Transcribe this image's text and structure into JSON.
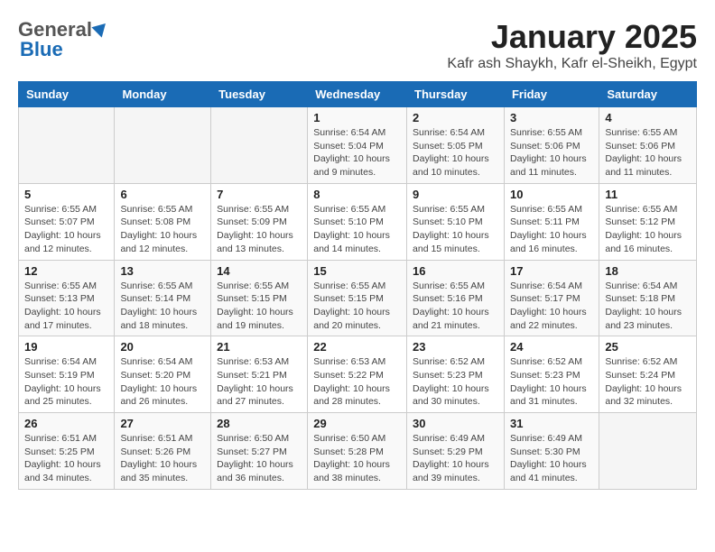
{
  "header": {
    "logo_general": "General",
    "logo_blue": "Blue",
    "month_title": "January 2025",
    "location": "Kafr ash Shaykh, Kafr el-Sheikh, Egypt"
  },
  "days_of_week": [
    "Sunday",
    "Monday",
    "Tuesday",
    "Wednesday",
    "Thursday",
    "Friday",
    "Saturday"
  ],
  "weeks": [
    {
      "days": [
        {
          "num": "",
          "info": ""
        },
        {
          "num": "",
          "info": ""
        },
        {
          "num": "",
          "info": ""
        },
        {
          "num": "1",
          "info": "Sunrise: 6:54 AM\nSunset: 5:04 PM\nDaylight: 10 hours\nand 9 minutes."
        },
        {
          "num": "2",
          "info": "Sunrise: 6:54 AM\nSunset: 5:05 PM\nDaylight: 10 hours\nand 10 minutes."
        },
        {
          "num": "3",
          "info": "Sunrise: 6:55 AM\nSunset: 5:06 PM\nDaylight: 10 hours\nand 11 minutes."
        },
        {
          "num": "4",
          "info": "Sunrise: 6:55 AM\nSunset: 5:06 PM\nDaylight: 10 hours\nand 11 minutes."
        }
      ]
    },
    {
      "days": [
        {
          "num": "5",
          "info": "Sunrise: 6:55 AM\nSunset: 5:07 PM\nDaylight: 10 hours\nand 12 minutes."
        },
        {
          "num": "6",
          "info": "Sunrise: 6:55 AM\nSunset: 5:08 PM\nDaylight: 10 hours\nand 12 minutes."
        },
        {
          "num": "7",
          "info": "Sunrise: 6:55 AM\nSunset: 5:09 PM\nDaylight: 10 hours\nand 13 minutes."
        },
        {
          "num": "8",
          "info": "Sunrise: 6:55 AM\nSunset: 5:10 PM\nDaylight: 10 hours\nand 14 minutes."
        },
        {
          "num": "9",
          "info": "Sunrise: 6:55 AM\nSunset: 5:10 PM\nDaylight: 10 hours\nand 15 minutes."
        },
        {
          "num": "10",
          "info": "Sunrise: 6:55 AM\nSunset: 5:11 PM\nDaylight: 10 hours\nand 16 minutes."
        },
        {
          "num": "11",
          "info": "Sunrise: 6:55 AM\nSunset: 5:12 PM\nDaylight: 10 hours\nand 16 minutes."
        }
      ]
    },
    {
      "days": [
        {
          "num": "12",
          "info": "Sunrise: 6:55 AM\nSunset: 5:13 PM\nDaylight: 10 hours\nand 17 minutes."
        },
        {
          "num": "13",
          "info": "Sunrise: 6:55 AM\nSunset: 5:14 PM\nDaylight: 10 hours\nand 18 minutes."
        },
        {
          "num": "14",
          "info": "Sunrise: 6:55 AM\nSunset: 5:15 PM\nDaylight: 10 hours\nand 19 minutes."
        },
        {
          "num": "15",
          "info": "Sunrise: 6:55 AM\nSunset: 5:15 PM\nDaylight: 10 hours\nand 20 minutes."
        },
        {
          "num": "16",
          "info": "Sunrise: 6:55 AM\nSunset: 5:16 PM\nDaylight: 10 hours\nand 21 minutes."
        },
        {
          "num": "17",
          "info": "Sunrise: 6:54 AM\nSunset: 5:17 PM\nDaylight: 10 hours\nand 22 minutes."
        },
        {
          "num": "18",
          "info": "Sunrise: 6:54 AM\nSunset: 5:18 PM\nDaylight: 10 hours\nand 23 minutes."
        }
      ]
    },
    {
      "days": [
        {
          "num": "19",
          "info": "Sunrise: 6:54 AM\nSunset: 5:19 PM\nDaylight: 10 hours\nand 25 minutes."
        },
        {
          "num": "20",
          "info": "Sunrise: 6:54 AM\nSunset: 5:20 PM\nDaylight: 10 hours\nand 26 minutes."
        },
        {
          "num": "21",
          "info": "Sunrise: 6:53 AM\nSunset: 5:21 PM\nDaylight: 10 hours\nand 27 minutes."
        },
        {
          "num": "22",
          "info": "Sunrise: 6:53 AM\nSunset: 5:22 PM\nDaylight: 10 hours\nand 28 minutes."
        },
        {
          "num": "23",
          "info": "Sunrise: 6:52 AM\nSunset: 5:23 PM\nDaylight: 10 hours\nand 30 minutes."
        },
        {
          "num": "24",
          "info": "Sunrise: 6:52 AM\nSunset: 5:23 PM\nDaylight: 10 hours\nand 31 minutes."
        },
        {
          "num": "25",
          "info": "Sunrise: 6:52 AM\nSunset: 5:24 PM\nDaylight: 10 hours\nand 32 minutes."
        }
      ]
    },
    {
      "days": [
        {
          "num": "26",
          "info": "Sunrise: 6:51 AM\nSunset: 5:25 PM\nDaylight: 10 hours\nand 34 minutes."
        },
        {
          "num": "27",
          "info": "Sunrise: 6:51 AM\nSunset: 5:26 PM\nDaylight: 10 hours\nand 35 minutes."
        },
        {
          "num": "28",
          "info": "Sunrise: 6:50 AM\nSunset: 5:27 PM\nDaylight: 10 hours\nand 36 minutes."
        },
        {
          "num": "29",
          "info": "Sunrise: 6:50 AM\nSunset: 5:28 PM\nDaylight: 10 hours\nand 38 minutes."
        },
        {
          "num": "30",
          "info": "Sunrise: 6:49 AM\nSunset: 5:29 PM\nDaylight: 10 hours\nand 39 minutes."
        },
        {
          "num": "31",
          "info": "Sunrise: 6:49 AM\nSunset: 5:30 PM\nDaylight: 10 hours\nand 41 minutes."
        },
        {
          "num": "",
          "info": ""
        }
      ]
    }
  ]
}
